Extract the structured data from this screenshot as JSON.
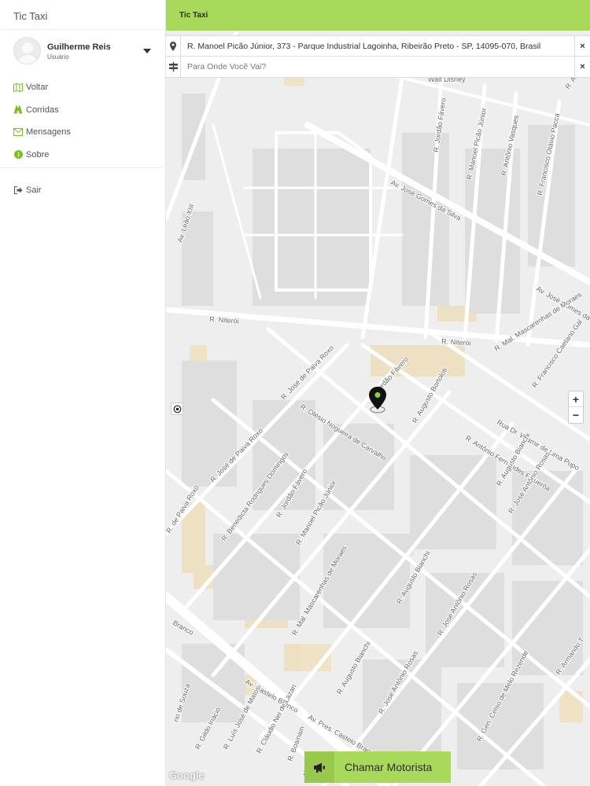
{
  "sidebar": {
    "brand": "Tic Taxi",
    "user": {
      "name": "Guilherme Reis",
      "role": "Usuário"
    },
    "menu": [
      {
        "label": "Voltar",
        "icon": "map-icon"
      },
      {
        "label": "Corridas",
        "icon": "road-icon"
      },
      {
        "label": "Mensagens",
        "icon": "envelope-icon"
      },
      {
        "label": "Sobre",
        "icon": "info-icon"
      }
    ],
    "logout": {
      "label": "Sair",
      "icon": "sign-out-icon"
    }
  },
  "header": {
    "title": "Tic Taxi"
  },
  "search": {
    "origin": {
      "value": "R. Manoel Picão Júnior, 373 - Parque Industrial Lagoinha, Ribeirão Preto - SP, 14095-070, Brasil",
      "icon": "map-pin-icon"
    },
    "destination": {
      "placeholder": "Para Onde Você Vai?",
      "icon": "signpost-icon"
    },
    "clear": "×"
  },
  "map": {
    "streets": [
      "Walt Disney",
      "R. Jordão Fávero",
      "R. Manoel Picão Júnior",
      "R. Antônio Vasques",
      "Av. José Gomes da Silva",
      "R. Francisco Otávio Pacca",
      "R. Antônio",
      "Av. Leão XIII",
      "R. Niterói",
      "R. Niterói",
      "Av. José Gomes da S",
      "R. Mal. Mascarenhas de Moraes",
      "R. Francisco Caetano Gal",
      "R. José de Paiva Roxo",
      "R. José de Paiva Roxo",
      "R. Olésio Nogueira de Carvalho",
      "R. Jordão Fávero",
      "R. Augusto Bortoloti",
      "Rua Dr. Wlamir de Lima Pupo",
      "R. Antônio Fernandes Figuerôa",
      "R. Augusto Bianchi",
      "R. José Antônio Rosas",
      "R. Benedicta Rodrigues Domingos",
      "R. Jordão Fávero",
      "R. Manoel Picão Júnior",
      "R. Mal. Mascarenhas de Moraes",
      "R. Augusto Bianchi",
      "R. José Antônio Rosas",
      "R. de Paiva Roxo",
      "Av. Castelo Branco",
      "Av. Pres. Castelo Branco",
      "Branco",
      "R. Armando T",
      "R. Gen. Celso de Melo Rezende",
      "R. José Antônio Rosas",
      "R. Augusto Bianchi",
      "rio de Souza",
      "R. Gildo Inácio",
      "R. Luís José de Matos",
      "R. Cláudio Nei de Lazari",
      "R. Boainain",
      "Abrão"
    ],
    "zoom_in": "+",
    "zoom_out": "−",
    "attribution": "Google"
  },
  "action": {
    "label": "Chamar Motorista",
    "icon": "bullhorn-icon"
  },
  "colors": {
    "accent": "#a8d95a",
    "accent_dark": "#98c94c",
    "map_bg": "#eeeeee",
    "road": "#ffffff",
    "block": "#dcdcdc",
    "sand": "#f0e2c4"
  }
}
